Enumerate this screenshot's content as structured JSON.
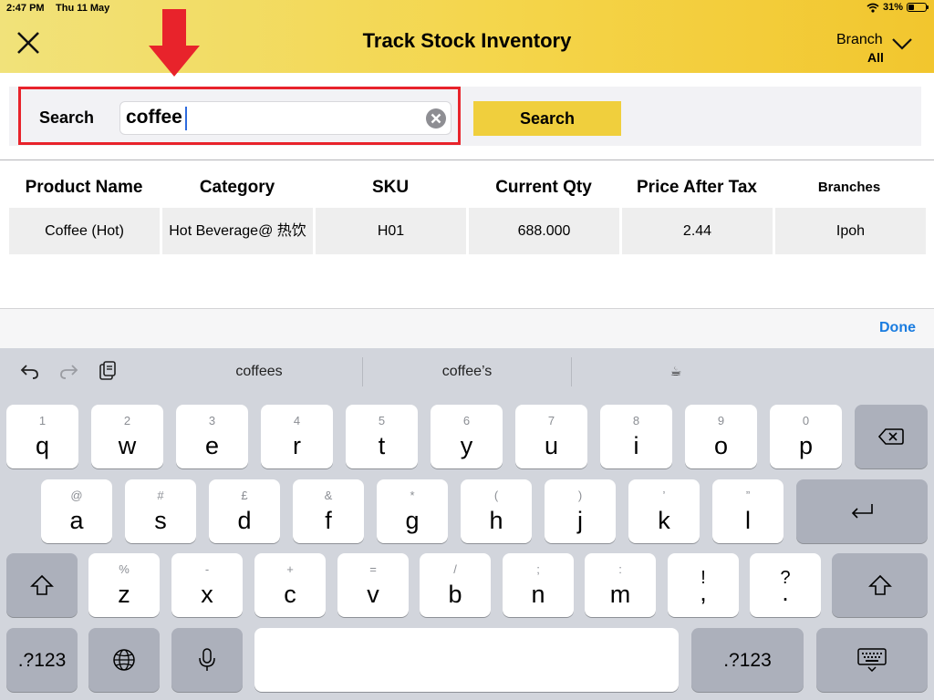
{
  "status_bar": {
    "time": "2:47 PM",
    "date": "Thu 11 May",
    "battery": "31%",
    "battery_level": 0.31
  },
  "header": {
    "title": "Track Stock Inventory",
    "branch_label": "Branch",
    "branch_value": "All"
  },
  "search": {
    "label": "Search",
    "query": "coffee",
    "button_label": "Search"
  },
  "table": {
    "headers": [
      "Product Name",
      "Category",
      "SKU",
      "Current Qty",
      "Price After Tax",
      "Branches"
    ],
    "rows": [
      [
        "Coffee (Hot)",
        "Hot Beverage@ 热饮",
        "H01",
        "688.000",
        "2.44",
        "Ipoh"
      ]
    ]
  },
  "accessory": {
    "done_label": "Done"
  },
  "keyboard": {
    "predictions": [
      "coffees",
      "coffee’s",
      "☕"
    ],
    "row1": [
      [
        "1",
        "q"
      ],
      [
        "2",
        "w"
      ],
      [
        "3",
        "e"
      ],
      [
        "4",
        "r"
      ],
      [
        "5",
        "t"
      ],
      [
        "6",
        "y"
      ],
      [
        "7",
        "u"
      ],
      [
        "8",
        "i"
      ],
      [
        "9",
        "o"
      ],
      [
        "0",
        "p"
      ]
    ],
    "row2": [
      [
        "@",
        "a"
      ],
      [
        "#",
        "s"
      ],
      [
        "£",
        "d"
      ],
      [
        "&",
        "f"
      ],
      [
        "*",
        "g"
      ],
      [
        "(",
        "h"
      ],
      [
        ")",
        "j"
      ],
      [
        "’",
        "k"
      ],
      [
        "”",
        "l"
      ]
    ],
    "row3": [
      [
        "%",
        "z"
      ],
      [
        "-",
        "x"
      ],
      [
        "+",
        "c"
      ],
      [
        "=",
        "v"
      ],
      [
        "/",
        "b"
      ],
      [
        ";",
        "n"
      ],
      [
        ":",
        "m"
      ],
      [
        "!",
        ","
      ],
      [
        "?",
        "."
      ]
    ],
    "numbers_label": ".?123"
  },
  "colors": {
    "header_yellow": "#f4d54a",
    "search_button": "#f0cf3d",
    "highlight_red": "#e8232b",
    "done_blue": "#1a7ce0"
  }
}
